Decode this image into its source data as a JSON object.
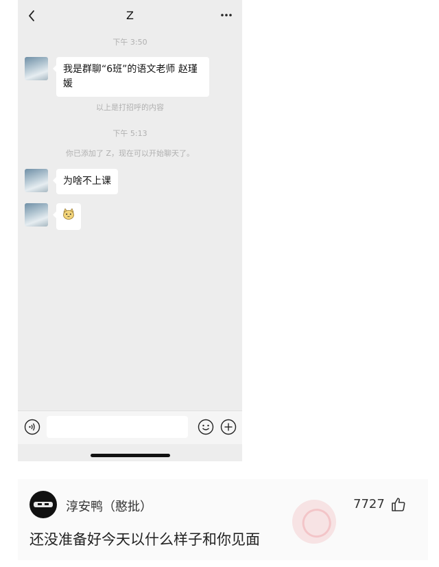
{
  "chat": {
    "title": "Z",
    "messages": {
      "time1": "下午 3:50",
      "msg1": "我是群聊“6班”的语文老师 赵瑾媛",
      "note1": "以上是打招呼的内容",
      "time2": "下午 5:13",
      "note2": "你已添加了 Z，现在可以开始聊天了。",
      "msg2": "为啥不上课"
    },
    "icons": [
      "back-icon",
      "more-icon",
      "voice-icon",
      "emoji-icon",
      "plus-icon",
      "cat-sticker"
    ]
  },
  "comment": {
    "username": "淳安鸭（憨批）",
    "likes": "7727",
    "text": "还没准备好今天以什么样子和你见面"
  }
}
